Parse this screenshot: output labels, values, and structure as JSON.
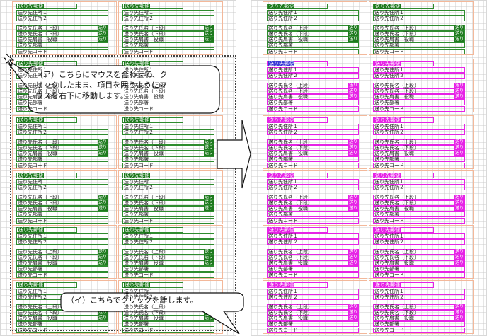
{
  "block": {
    "header": "送り先郵便",
    "address1": "送り先住所１",
    "address2": "送り先住所２",
    "name_upper": "送り先氏名（上段）",
    "name_lower": "送り先氏名（下段）",
    "title": "送り先肩書　役職",
    "company": "送り先部署",
    "code": "送り先コード",
    "tag": "送り"
  },
  "callouts": {
    "a_lines": [
      "（ア）こちらにマウスを合わせて、ク",
      "リックしたまま、項目を囲うようにマ",
      "ウスを右下に移動します。"
    ],
    "i_text": "（イ）こちらでクリックを離します。"
  },
  "colors": {
    "unselected": "#2f8c2f",
    "selected": "#e623e6",
    "first_selected": "#3a3ad6",
    "guide": "#f3b89a"
  }
}
